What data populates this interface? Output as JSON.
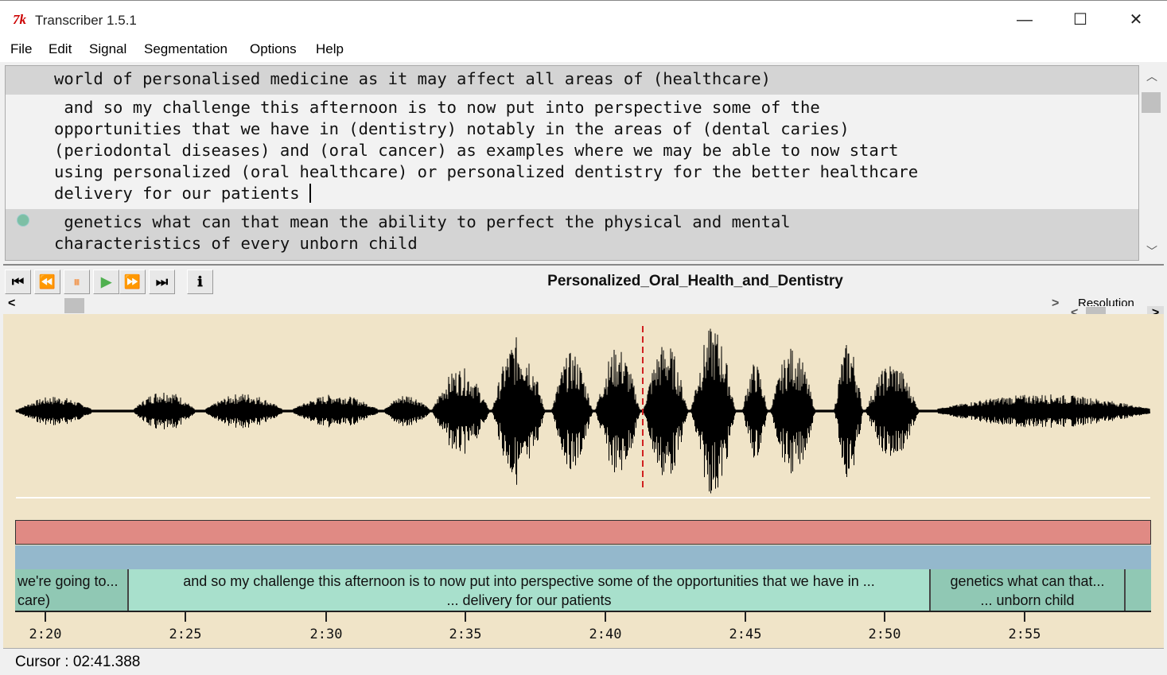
{
  "window": {
    "title": "Transcriber 1.5.1",
    "app_icon": "tk-icon",
    "minimize": "—",
    "maximize": "☐",
    "close": "✕"
  },
  "menu": [
    "File",
    "Edit",
    "Signal",
    "Segmentation",
    "Options",
    "Help"
  ],
  "transcript": [
    "world of personalised medicine as it may affect all areas of (healthcare)",
    " and so my challenge this afternoon is to now put into perspective some of the\nopportunities that we have in (dentistry) notably in the areas of (dental caries)\n(periodontal diseases) and (oral cancer) as examples where we may be able to now start\nusing personalized (oral healthcare) or personalized dentistry for the better healthcare\ndelivery for our patients ",
    " genetics what can that mean the ability to perfect the physical and mental\ncharacteristics of every unborn child"
  ],
  "toolbar": {
    "buttons": [
      "⏮",
      "⏪",
      "⏸",
      "▶",
      "⏩",
      "⏭",
      "ℹ"
    ],
    "filename": "Personalized_Oral_Health_and_Dentistry"
  },
  "resolution_label": "Resolution",
  "segments": [
    {
      "line1": "we're going to...",
      "line2": "care)"
    },
    {
      "line1": "and so my challenge this afternoon is to now put into perspective some of the opportunities that we have in ...",
      "line2": "... delivery for our patients"
    },
    {
      "line1": "genetics what can that...",
      "line2": "... unborn child"
    }
  ],
  "timeline": [
    "2:20",
    "2:25",
    "2:30",
    "2:35",
    "2:40",
    "2:45",
    "2:50",
    "2:55"
  ],
  "status": {
    "cursor": "Cursor : 02:41.388"
  },
  "colors": {
    "wave_bg": "#f0e4c8",
    "cursor": "#d02020",
    "band1": "#e08a84",
    "band2": "#94b8cc",
    "segment": "#a8e0cc"
  }
}
